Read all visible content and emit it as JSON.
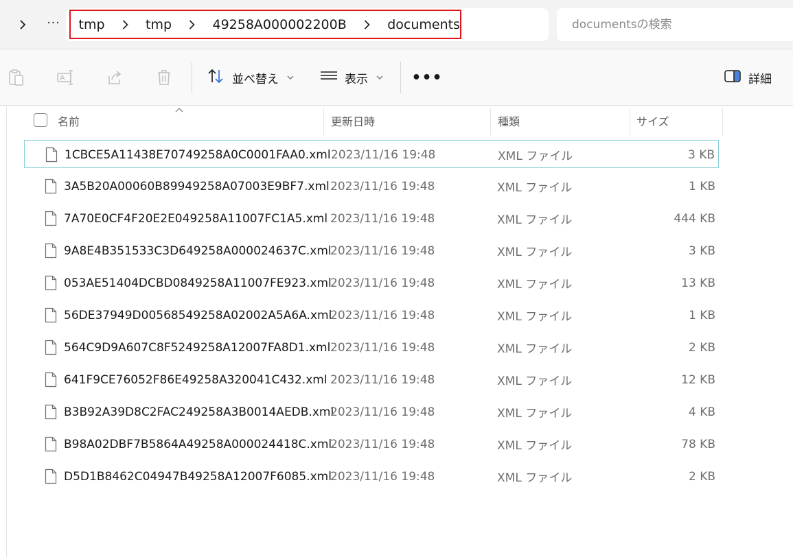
{
  "address": {
    "breadcrumbs": [
      {
        "label": "tmp"
      },
      {
        "label": "tmp"
      },
      {
        "label": "49258A000002200B"
      },
      {
        "label": "documents"
      }
    ]
  },
  "search": {
    "placeholder": "documentsの検索"
  },
  "toolbar": {
    "sort_label": "並べ替え",
    "view_label": "表示",
    "details_label": "詳細"
  },
  "columns": {
    "name": "名前",
    "date": "更新日時",
    "type": "種類",
    "size": "サイズ"
  },
  "files": [
    {
      "name": "1CBCE5A11438E70749258A0C0001FAA0.xml",
      "date": "2023/11/16 19:48",
      "type": "XML ファイル",
      "size": "3 KB"
    },
    {
      "name": "3A5B20A00060B89949258A07003E9BF7.xml",
      "date": "2023/11/16 19:48",
      "type": "XML ファイル",
      "size": "1 KB"
    },
    {
      "name": "7A70E0CF4F20E2E049258A11007FC1A5.xml",
      "date": "2023/11/16 19:48",
      "type": "XML ファイル",
      "size": "444 KB"
    },
    {
      "name": "9A8E4B351533C3D649258A000024637C.xml",
      "date": "2023/11/16 19:48",
      "type": "XML ファイル",
      "size": "3 KB"
    },
    {
      "name": "053AE51404DCBD0849258A11007FE923.xml",
      "date": "2023/11/16 19:48",
      "type": "XML ファイル",
      "size": "13 KB"
    },
    {
      "name": "56DE37949D00568549258A02002A5A6A.xml",
      "date": "2023/11/16 19:48",
      "type": "XML ファイル",
      "size": "1 KB"
    },
    {
      "name": "564C9D9A607C8F5249258A12007FA8D1.xml",
      "date": "2023/11/16 19:48",
      "type": "XML ファイル",
      "size": "2 KB"
    },
    {
      "name": "641F9CE76052F86E49258A320041C432.xml",
      "date": "2023/11/16 19:48",
      "type": "XML ファイル",
      "size": "12 KB"
    },
    {
      "name": "B3B92A39D8C2FAC249258A3B0014AEDB.xml",
      "date": "2023/11/16 19:48",
      "type": "XML ファイル",
      "size": "4 KB"
    },
    {
      "name": "B98A02DBF7B5864A49258A000024418C.xml",
      "date": "2023/11/16 19:48",
      "type": "XML ファイル",
      "size": "78 KB"
    },
    {
      "name": "D5D1B8462C04947B49258A12007F6085.xml",
      "date": "2023/11/16 19:48",
      "type": "XML ファイル",
      "size": "2 KB"
    }
  ],
  "colors": {
    "highlight_border": "#e0141a",
    "selection_border": "#8bcfd9"
  }
}
